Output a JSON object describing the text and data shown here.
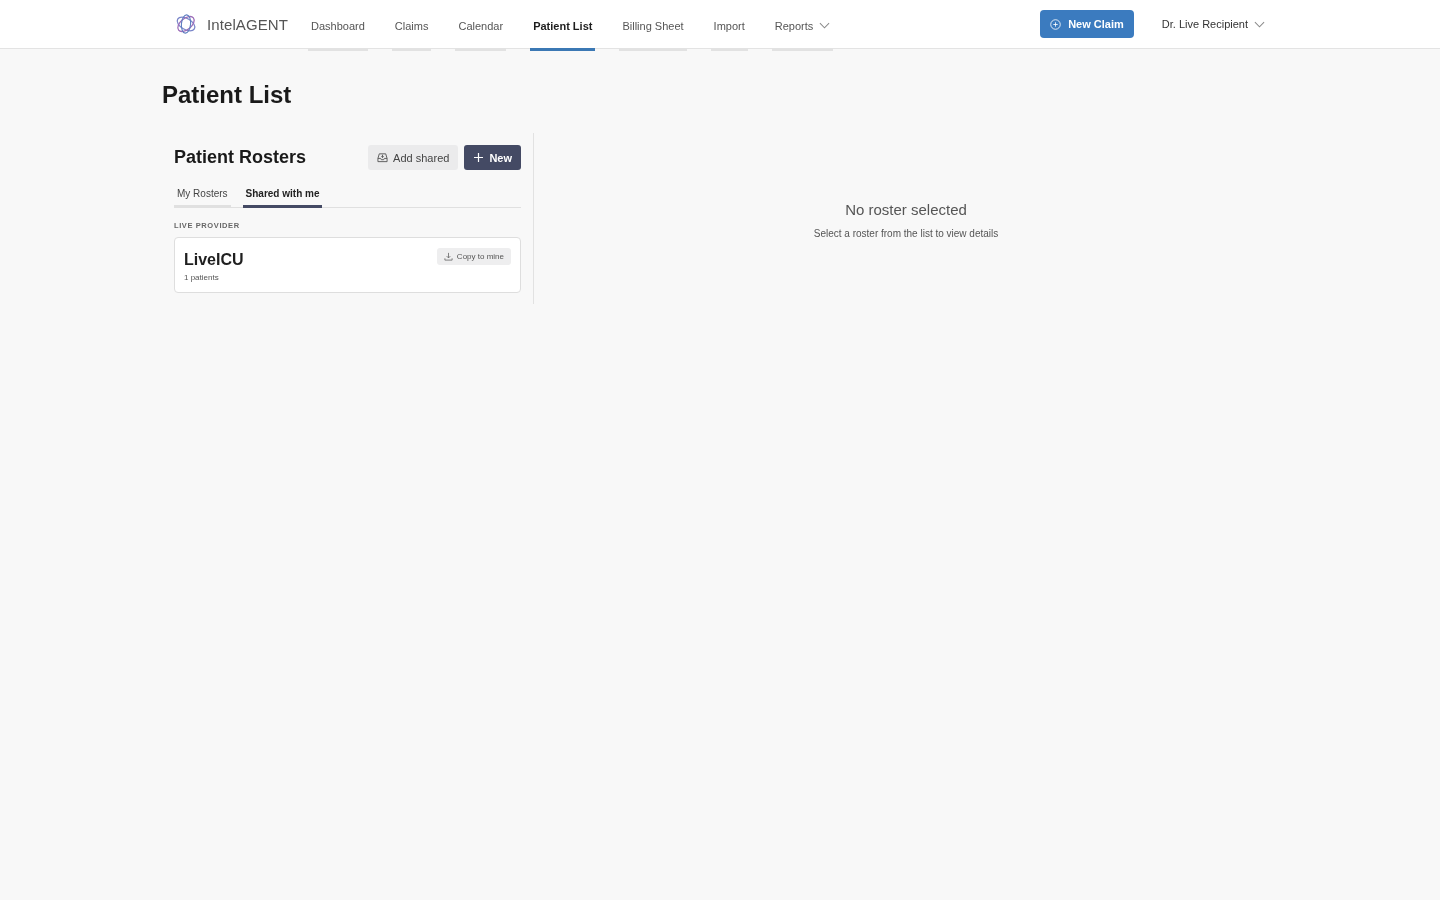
{
  "header": {
    "logo": {
      "text": "IntelAGENT"
    },
    "nav": [
      {
        "label": "Dashboard",
        "kind": "link",
        "selected": false
      },
      {
        "label": "Claims",
        "kind": "link",
        "selected": false
      },
      {
        "label": "Calendar",
        "kind": "link",
        "selected": false
      },
      {
        "label": "Patient List",
        "kind": "link",
        "selected": true
      },
      {
        "label": "Billing Sheet",
        "kind": "link",
        "selected": false
      },
      {
        "label": "Import",
        "kind": "link",
        "selected": false
      },
      {
        "label": "Reports",
        "kind": "dropdown",
        "selected": false
      }
    ],
    "new_claim_button": {
      "label": "New Claim"
    },
    "user_menu": {
      "label": "Dr. Live Recipient"
    }
  },
  "page": {
    "title": "Patient List"
  },
  "rosters_panel": {
    "title": "Patient Rosters",
    "buttons": [
      {
        "label": "Add shared",
        "kind": "secondary"
      },
      {
        "label": "New",
        "kind": "primary"
      }
    ],
    "tabs": [
      {
        "label": "My Rosters",
        "selected": false
      },
      {
        "label": "Shared with me",
        "selected": true
      }
    ],
    "groups": [
      {
        "heading": "LIVE PROVIDER",
        "rosters": [
          {
            "name": "LiveICU",
            "count": "1 patients",
            "action": "Copy to mine"
          }
        ]
      }
    ]
  },
  "detail": {
    "title": "No roster selected",
    "message": "Select a roster from the list to view details"
  }
}
